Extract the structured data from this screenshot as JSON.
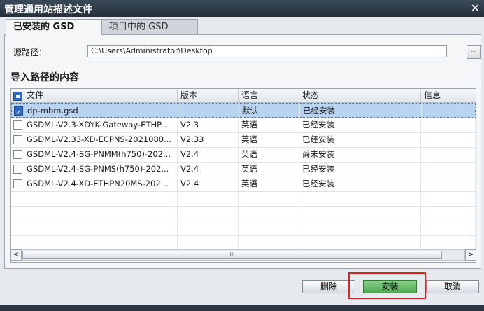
{
  "window": {
    "title": "管理通用站描述文件",
    "close_glyph": "✕"
  },
  "tabs": [
    {
      "label": "已安装的 GSD",
      "active": true
    },
    {
      "label": "项目中的 GSD",
      "active": false
    }
  ],
  "source": {
    "label": "源路径：",
    "path": "C:\\Users\\Administrator\\Desktop",
    "browse_label": "..."
  },
  "section_title": "导入路径的内容",
  "table": {
    "columns": [
      "文件",
      "版本",
      "语言",
      "状态",
      "信息"
    ],
    "rows": [
      {
        "file": "dp-mbm.gsd",
        "version": "",
        "language": "默认",
        "status": "已经安装",
        "info": "",
        "checked": true,
        "selected": true
      },
      {
        "file": "GSDML-V2.3-XDYK-Gateway-ETHP...",
        "version": "V2.3",
        "language": "英语",
        "status": "已经安装",
        "info": "",
        "checked": false,
        "selected": false
      },
      {
        "file": "GSDML-V2.33-XD-ECPNS-2021080...",
        "version": "V2.33",
        "language": "英语",
        "status": "已经安装",
        "info": "",
        "checked": false,
        "selected": false
      },
      {
        "file": "GSDML-V2.4-SG-PNMM(h750)-202...",
        "version": "V2.4",
        "language": "英语",
        "status": "尚未安装",
        "info": "",
        "checked": false,
        "selected": false
      },
      {
        "file": "GSDML-V2.4-SG-PNMS(h750)-202...",
        "version": "V2.4",
        "language": "英语",
        "status": "已经安装",
        "info": "",
        "checked": false,
        "selected": false
      },
      {
        "file": "GSDML-V2.4-XD-ETHPN20MS-202...",
        "version": "V2.4",
        "language": "英语",
        "status": "已经安装",
        "info": "",
        "checked": false,
        "selected": false
      }
    ]
  },
  "scrollbar": {
    "left_glyph": "<",
    "right_glyph": ">",
    "thumb_glyph": "III"
  },
  "buttons": {
    "delete": "删除",
    "install": "安装",
    "cancel": "取消"
  }
}
